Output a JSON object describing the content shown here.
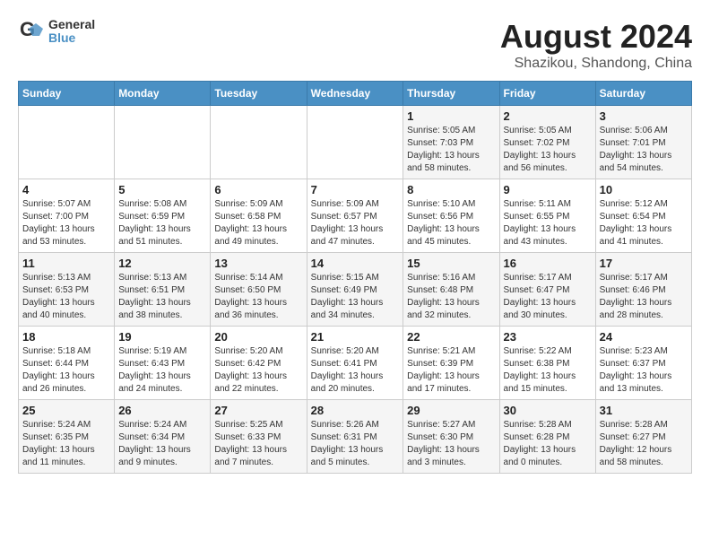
{
  "header": {
    "logo_line1": "General",
    "logo_line2": "Blue",
    "month_year": "August 2024",
    "location": "Shazikou, Shandong, China"
  },
  "weekdays": [
    "Sunday",
    "Monday",
    "Tuesday",
    "Wednesday",
    "Thursday",
    "Friday",
    "Saturday"
  ],
  "weeks": [
    [
      {
        "day": "",
        "content": ""
      },
      {
        "day": "",
        "content": ""
      },
      {
        "day": "",
        "content": ""
      },
      {
        "day": "",
        "content": ""
      },
      {
        "day": "1",
        "content": "Sunrise: 5:05 AM\nSunset: 7:03 PM\nDaylight: 13 hours\nand 58 minutes."
      },
      {
        "day": "2",
        "content": "Sunrise: 5:05 AM\nSunset: 7:02 PM\nDaylight: 13 hours\nand 56 minutes."
      },
      {
        "day": "3",
        "content": "Sunrise: 5:06 AM\nSunset: 7:01 PM\nDaylight: 13 hours\nand 54 minutes."
      }
    ],
    [
      {
        "day": "4",
        "content": "Sunrise: 5:07 AM\nSunset: 7:00 PM\nDaylight: 13 hours\nand 53 minutes."
      },
      {
        "day": "5",
        "content": "Sunrise: 5:08 AM\nSunset: 6:59 PM\nDaylight: 13 hours\nand 51 minutes."
      },
      {
        "day": "6",
        "content": "Sunrise: 5:09 AM\nSunset: 6:58 PM\nDaylight: 13 hours\nand 49 minutes."
      },
      {
        "day": "7",
        "content": "Sunrise: 5:09 AM\nSunset: 6:57 PM\nDaylight: 13 hours\nand 47 minutes."
      },
      {
        "day": "8",
        "content": "Sunrise: 5:10 AM\nSunset: 6:56 PM\nDaylight: 13 hours\nand 45 minutes."
      },
      {
        "day": "9",
        "content": "Sunrise: 5:11 AM\nSunset: 6:55 PM\nDaylight: 13 hours\nand 43 minutes."
      },
      {
        "day": "10",
        "content": "Sunrise: 5:12 AM\nSunset: 6:54 PM\nDaylight: 13 hours\nand 41 minutes."
      }
    ],
    [
      {
        "day": "11",
        "content": "Sunrise: 5:13 AM\nSunset: 6:53 PM\nDaylight: 13 hours\nand 40 minutes."
      },
      {
        "day": "12",
        "content": "Sunrise: 5:13 AM\nSunset: 6:51 PM\nDaylight: 13 hours\nand 38 minutes."
      },
      {
        "day": "13",
        "content": "Sunrise: 5:14 AM\nSunset: 6:50 PM\nDaylight: 13 hours\nand 36 minutes."
      },
      {
        "day": "14",
        "content": "Sunrise: 5:15 AM\nSunset: 6:49 PM\nDaylight: 13 hours\nand 34 minutes."
      },
      {
        "day": "15",
        "content": "Sunrise: 5:16 AM\nSunset: 6:48 PM\nDaylight: 13 hours\nand 32 minutes."
      },
      {
        "day": "16",
        "content": "Sunrise: 5:17 AM\nSunset: 6:47 PM\nDaylight: 13 hours\nand 30 minutes."
      },
      {
        "day": "17",
        "content": "Sunrise: 5:17 AM\nSunset: 6:46 PM\nDaylight: 13 hours\nand 28 minutes."
      }
    ],
    [
      {
        "day": "18",
        "content": "Sunrise: 5:18 AM\nSunset: 6:44 PM\nDaylight: 13 hours\nand 26 minutes."
      },
      {
        "day": "19",
        "content": "Sunrise: 5:19 AM\nSunset: 6:43 PM\nDaylight: 13 hours\nand 24 minutes."
      },
      {
        "day": "20",
        "content": "Sunrise: 5:20 AM\nSunset: 6:42 PM\nDaylight: 13 hours\nand 22 minutes."
      },
      {
        "day": "21",
        "content": "Sunrise: 5:20 AM\nSunset: 6:41 PM\nDaylight: 13 hours\nand 20 minutes."
      },
      {
        "day": "22",
        "content": "Sunrise: 5:21 AM\nSunset: 6:39 PM\nDaylight: 13 hours\nand 17 minutes."
      },
      {
        "day": "23",
        "content": "Sunrise: 5:22 AM\nSunset: 6:38 PM\nDaylight: 13 hours\nand 15 minutes."
      },
      {
        "day": "24",
        "content": "Sunrise: 5:23 AM\nSunset: 6:37 PM\nDaylight: 13 hours\nand 13 minutes."
      }
    ],
    [
      {
        "day": "25",
        "content": "Sunrise: 5:24 AM\nSunset: 6:35 PM\nDaylight: 13 hours\nand 11 minutes."
      },
      {
        "day": "26",
        "content": "Sunrise: 5:24 AM\nSunset: 6:34 PM\nDaylight: 13 hours\nand 9 minutes."
      },
      {
        "day": "27",
        "content": "Sunrise: 5:25 AM\nSunset: 6:33 PM\nDaylight: 13 hours\nand 7 minutes."
      },
      {
        "day": "28",
        "content": "Sunrise: 5:26 AM\nSunset: 6:31 PM\nDaylight: 13 hours\nand 5 minutes."
      },
      {
        "day": "29",
        "content": "Sunrise: 5:27 AM\nSunset: 6:30 PM\nDaylight: 13 hours\nand 3 minutes."
      },
      {
        "day": "30",
        "content": "Sunrise: 5:28 AM\nSunset: 6:28 PM\nDaylight: 13 hours\nand 0 minutes."
      },
      {
        "day": "31",
        "content": "Sunrise: 5:28 AM\nSunset: 6:27 PM\nDaylight: 12 hours\nand 58 minutes."
      }
    ]
  ]
}
